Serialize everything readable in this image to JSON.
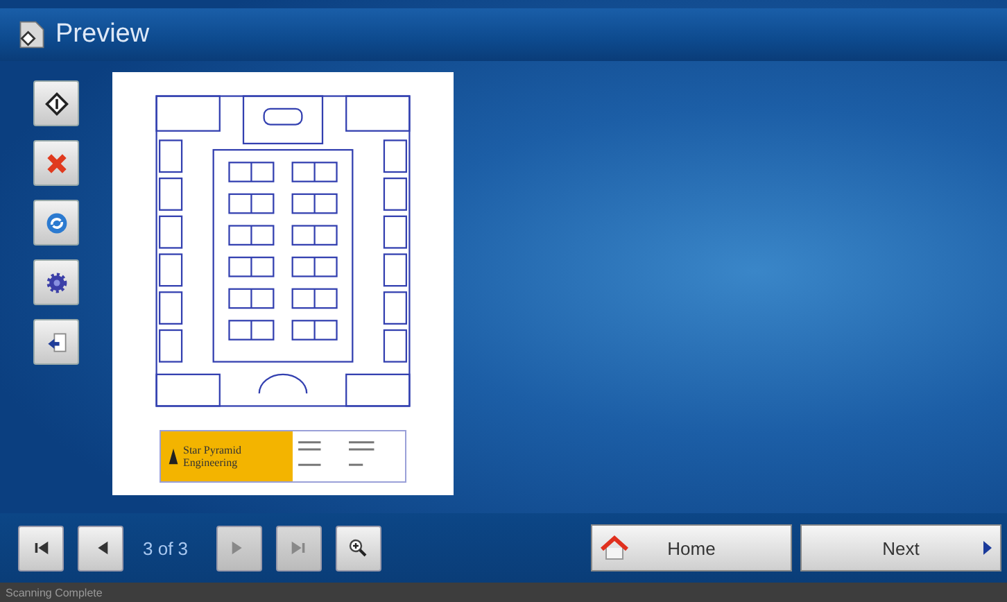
{
  "window": {
    "title": "Preview"
  },
  "tools": [
    {
      "kind": "start"
    },
    {
      "kind": "cancel"
    },
    {
      "kind": "rotate"
    },
    {
      "kind": "settings"
    },
    {
      "kind": "return"
    }
  ],
  "document": {
    "company": [
      "Star Pyramid",
      "Engineering"
    ]
  },
  "pager": {
    "text": "3 of 3",
    "buttons": [
      {
        "kind": "first",
        "disabled": false
      },
      {
        "kind": "prev",
        "disabled": false
      },
      {
        "kind": "next",
        "disabled": true
      },
      {
        "kind": "last",
        "disabled": true
      }
    ],
    "zoom": {
      "disabled": false
    }
  },
  "actions": [
    {
      "kind": "home",
      "label": "Home"
    },
    {
      "kind": "next",
      "label": "Next"
    }
  ],
  "status_bar": {
    "text": "Scanning Complete"
  }
}
